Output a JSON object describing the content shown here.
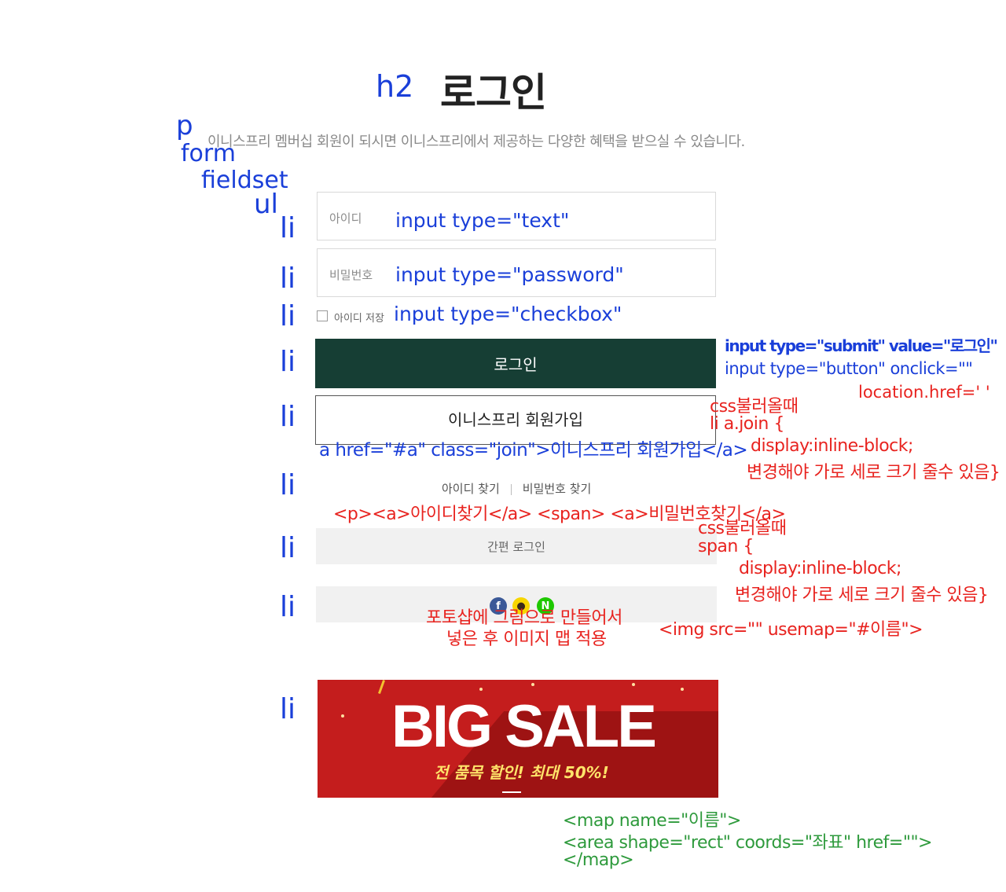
{
  "title": "로그인",
  "description": "이니스프리 멤버십 회원이 되시면 이니스프리에서 제공하는 다양한 혜택을 받으실 수 있습니다.",
  "form": {
    "id_label": "아이디",
    "pw_label": "비밀번호",
    "save_id_label": "아이디 저장",
    "login_button": "로그인",
    "join_button": "이니스프리 회원가입",
    "find_id": "아이디 찾기",
    "find_pw": "비밀번호 찾기",
    "simple_login": "간편 로그인",
    "social": [
      "f",
      "●",
      "N"
    ]
  },
  "banner": {
    "title": "BIG SALE",
    "subtitle": "전 품목 할인! 최대 50%!"
  },
  "annotations": {
    "h2": "h2",
    "p": "p",
    "form": "form",
    "fieldset": "fieldset",
    "ul": "ul",
    "li": "li",
    "input_text": "input type=\"text\"",
    "input_password": "input type=\"password\"",
    "input_checkbox": "input type=\"checkbox\"",
    "input_submit": "input type=\"submit\" value=\"로그인\"",
    "input_button": "input type=\"button\" onclick=\"\"",
    "location_href": "location.href='  '",
    "css_load_1": "css불러올때",
    "li_a_join": "li a.join {",
    "a_href_join": "a href=\"#a\" class=\"join\">이니스프리 회원가입</a>",
    "display_inline_block_1": "display:inline-block;",
    "change_size_1": "변경해야 가로 세로 크기 줄수 있음}",
    "p_a_find": "<p><a>아이디찾기</a> <span> <a>비밀번호찾기</a>",
    "css_load_2": "css불러올때",
    "span_open": "span {",
    "display_inline_block_2": "display:inline-block;",
    "change_size_2": "변경해야 가로 세로 크기 줄수 있음}",
    "photoshop_1": "포토샵에 그림으로 만들어서",
    "photoshop_2": "넣은 후 이미지 맵 적용",
    "img_usemap": "<img src=\"\" usemap=\"#이름\">",
    "map_open": "<map name=\"이름\">",
    "area": "<area shape=\"rect\" coords=\"좌표\" href=\"\">",
    "map_close": "</map>"
  },
  "colors": {
    "annotation_blue": "#1a3fd9",
    "annotation_red": "#e8231f",
    "annotation_green": "#2e9a3c",
    "login_button": "#163e34",
    "banner": "#c41d1d"
  }
}
